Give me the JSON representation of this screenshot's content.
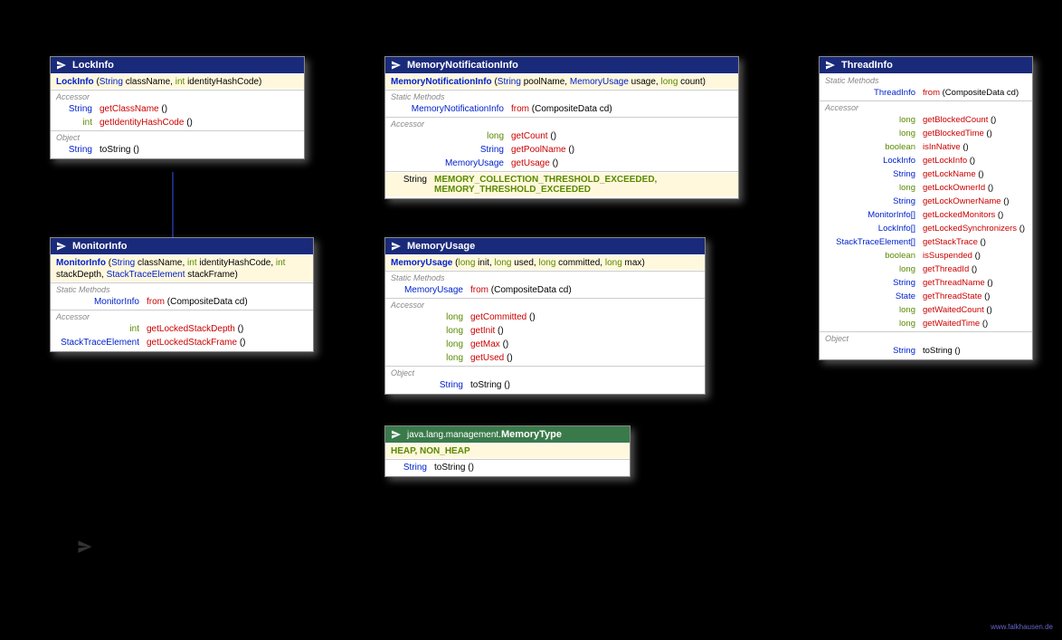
{
  "package_label": "java.lang.management",
  "footer": "www.falkhausen.de",
  "cards": {
    "lockinfo": {
      "title": "LockInfo",
      "ctor": {
        "name": "LockInfo",
        "params": [
          [
            "String",
            "className"
          ],
          [
            "int",
            "identityHashCode"
          ]
        ]
      },
      "sections": [
        {
          "label": "Accessor",
          "rows": [
            {
              "ret": "String",
              "name": "getClassName",
              "params": "()",
              "acc": true
            },
            {
              "ret": "int",
              "name": "getIdentityHashCode",
              "params": "()",
              "acc": true
            }
          ]
        },
        {
          "label": "Object",
          "rows": [
            {
              "ret": "String",
              "name": "toString",
              "params": "()"
            }
          ]
        }
      ]
    },
    "monitorinfo": {
      "title": "MonitorInfo",
      "ctor": {
        "name": "MonitorInfo",
        "params": [
          [
            "String",
            "className"
          ],
          [
            "int",
            "identityHashCode"
          ],
          [
            "int",
            "stackDepth"
          ],
          [
            "StackTraceElement",
            "stackFrame"
          ]
        ]
      },
      "sections": [
        {
          "label": "Static Methods",
          "rows": [
            {
              "ret": "MonitorInfo",
              "retlink": true,
              "name": "from",
              "params": "(CompositeData cd)",
              "acc": true
            }
          ]
        },
        {
          "label": "Accessor",
          "rows": [
            {
              "ret": "int",
              "name": "getLockedStackDepth",
              "params": "()",
              "acc": true
            },
            {
              "ret": "StackTraceElement",
              "retlink": true,
              "name": "getLockedStackFrame",
              "params": "()",
              "acc": true
            }
          ]
        }
      ]
    },
    "memnotif": {
      "title": "MemoryNotificationInfo",
      "ctor": {
        "name": "MemoryNotificationInfo",
        "params": [
          [
            "String",
            "poolName"
          ],
          [
            "MemoryUsage",
            "usage"
          ],
          [
            "long",
            "count"
          ]
        ]
      },
      "sections": [
        {
          "label": "Static Methods",
          "rows": [
            {
              "ret": "MemoryNotificationInfo",
              "retlink": true,
              "name": "from",
              "params": "(CompositeData cd)",
              "acc": true
            }
          ]
        },
        {
          "label": "Accessor",
          "rows": [
            {
              "ret": "long",
              "name": "getCount",
              "params": "()",
              "acc": true
            },
            {
              "ret": "String",
              "name": "getPoolName",
              "params": "()",
              "acc": true
            },
            {
              "ret": "MemoryUsage",
              "retlink": true,
              "name": "getUsage",
              "params": "()",
              "acc": true
            }
          ]
        }
      ],
      "consts": [
        [
          "String",
          "MEMORY_COLLECTION_THRESHOLD_EXCEEDED,"
        ],
        [
          "",
          "MEMORY_THRESHOLD_EXCEEDED"
        ]
      ]
    },
    "memusage": {
      "title": "MemoryUsage",
      "ctor": {
        "name": "MemoryUsage",
        "params": [
          [
            "long",
            "init"
          ],
          [
            "long",
            "used"
          ],
          [
            "long",
            "committed"
          ],
          [
            "long",
            "max"
          ]
        ]
      },
      "sections": [
        {
          "label": "Static Methods",
          "rows": [
            {
              "ret": "MemoryUsage",
              "retlink": true,
              "name": "from",
              "params": "(CompositeData cd)",
              "acc": true
            }
          ]
        },
        {
          "label": "Accessor",
          "rows": [
            {
              "ret": "long",
              "name": "getCommitted",
              "params": "()",
              "acc": true
            },
            {
              "ret": "long",
              "name": "getInit",
              "params": "()",
              "acc": true
            },
            {
              "ret": "long",
              "name": "getMax",
              "params": "()",
              "acc": true
            },
            {
              "ret": "long",
              "name": "getUsed",
              "params": "()",
              "acc": true
            }
          ]
        },
        {
          "label": "Object",
          "rows": [
            {
              "ret": "String",
              "name": "toString",
              "params": "()"
            }
          ]
        }
      ]
    },
    "memtype": {
      "title": "MemoryType",
      "pkg": "java.lang.management.",
      "enumvals": "HEAP, NON_HEAP",
      "sections": [
        {
          "label": "",
          "rows": [
            {
              "ret": "String",
              "name": "toString",
              "params": "()"
            }
          ]
        }
      ]
    },
    "threadinfo": {
      "title": "ThreadInfo",
      "sections": [
        {
          "label": "Static Methods",
          "rows": [
            {
              "ret": "ThreadInfo",
              "retlink": true,
              "name": "from",
              "params": "(CompositeData cd)",
              "acc": true
            }
          ]
        },
        {
          "label": "Accessor",
          "rows": [
            {
              "ret": "long",
              "name": "getBlockedCount",
              "params": "()",
              "acc": true
            },
            {
              "ret": "long",
              "name": "getBlockedTime",
              "params": "()",
              "acc": true
            },
            {
              "ret": "boolean",
              "name": "isInNative",
              "params": "()",
              "acc": true
            },
            {
              "ret": "LockInfo",
              "retlink": true,
              "name": "getLockInfo",
              "params": "()",
              "acc": true
            },
            {
              "ret": "String",
              "name": "getLockName",
              "params": "()",
              "acc": true
            },
            {
              "ret": "long",
              "name": "getLockOwnerId",
              "params": "()",
              "acc": true
            },
            {
              "ret": "String",
              "name": "getLockOwnerName",
              "params": "()",
              "acc": true
            },
            {
              "ret": "MonitorInfo[]",
              "retlink": true,
              "name": "getLockedMonitors",
              "params": "()",
              "acc": true
            },
            {
              "ret": "LockInfo[]",
              "retlink": true,
              "name": "getLockedSynchronizers",
              "params": "()",
              "acc": true
            },
            {
              "ret": "StackTraceElement[]",
              "retlink": true,
              "name": "getStackTrace",
              "params": "()",
              "acc": true
            },
            {
              "ret": "boolean",
              "name": "isSuspended",
              "params": "()",
              "acc": true
            },
            {
              "ret": "long",
              "name": "getThreadId",
              "params": "()",
              "acc": true
            },
            {
              "ret": "String",
              "name": "getThreadName",
              "params": "()",
              "acc": true
            },
            {
              "ret": "State",
              "retlink": true,
              "name": "getThreadState",
              "params": "()",
              "acc": true
            },
            {
              "ret": "long",
              "name": "getWaitedCount",
              "params": "()",
              "acc": true
            },
            {
              "ret": "long",
              "name": "getWaitedTime",
              "params": "()",
              "acc": true
            }
          ]
        },
        {
          "label": "Object",
          "rows": [
            {
              "ret": "String",
              "name": "toString",
              "params": "()"
            }
          ]
        }
      ]
    }
  }
}
